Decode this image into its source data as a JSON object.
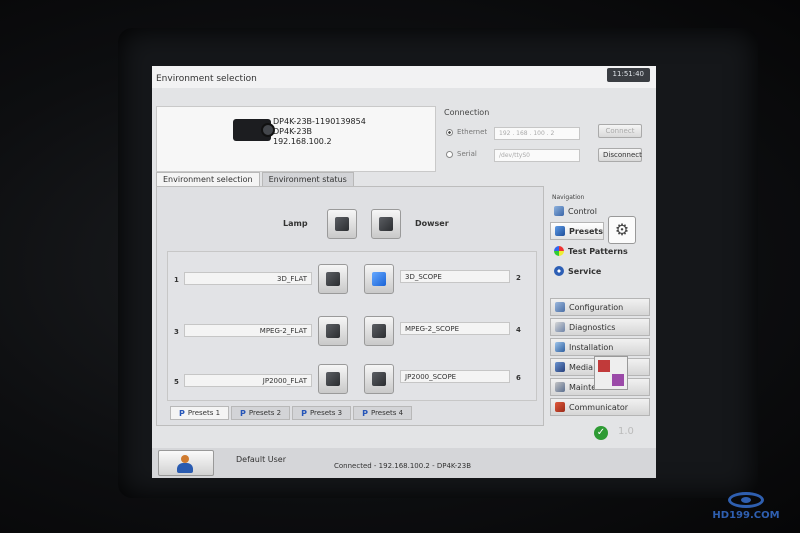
{
  "window": {
    "title": "Environment selection",
    "clock": "11:51:40"
  },
  "device": {
    "line1": "DP4K-23B-1190139854",
    "line2": "DP4K-23B",
    "line3": "192.168.100.2"
  },
  "connection": {
    "header": "Connection",
    "ethernet_label": "Ethernet",
    "serial_label": "Serial",
    "ip_value": "192 . 168 . 100 . 2",
    "serial_value": "/dev/ttyS0",
    "connect_label": "Connect",
    "disconnect_label": "Disconnect"
  },
  "tabs": [
    "Environment selection",
    "Environment status"
  ],
  "lamp": {
    "label": "Lamp"
  },
  "dowser": {
    "label": "Dowser"
  },
  "presets": [
    {
      "num": "1",
      "name": "3D_FLAT",
      "active": false
    },
    {
      "num": "2",
      "name": "3D_SCOPE",
      "active": true
    },
    {
      "num": "3",
      "name": "MPEG-2_FLAT",
      "active": false
    },
    {
      "num": "4",
      "name": "MPEG-2_SCOPE",
      "active": false
    },
    {
      "num": "5",
      "name": "JP2000_FLAT",
      "active": false
    },
    {
      "num": "6",
      "name": "JP2000_SCOPE",
      "active": false
    }
  ],
  "preset_tabs": [
    "Presets 1",
    "Presets 2",
    "Presets 3",
    "Presets 4"
  ],
  "status": {
    "user": "Default User",
    "connection": "Connected  -  192.168.100.2  -  DP4K-23B"
  },
  "navigation": {
    "header": "Navigation",
    "items": [
      "Control",
      "Presets",
      "Test Patterns",
      "Service",
      "Configuration",
      "Diagnostics",
      "Installation",
      "Media",
      "Maintenance",
      "Communicator"
    ]
  },
  "version": "1.0",
  "watermark": "HD199.COM",
  "colors": {
    "screen_bg": "#e3e4e6",
    "active_preset": "#2a7be0",
    "accent_blue": "#2555b8"
  }
}
